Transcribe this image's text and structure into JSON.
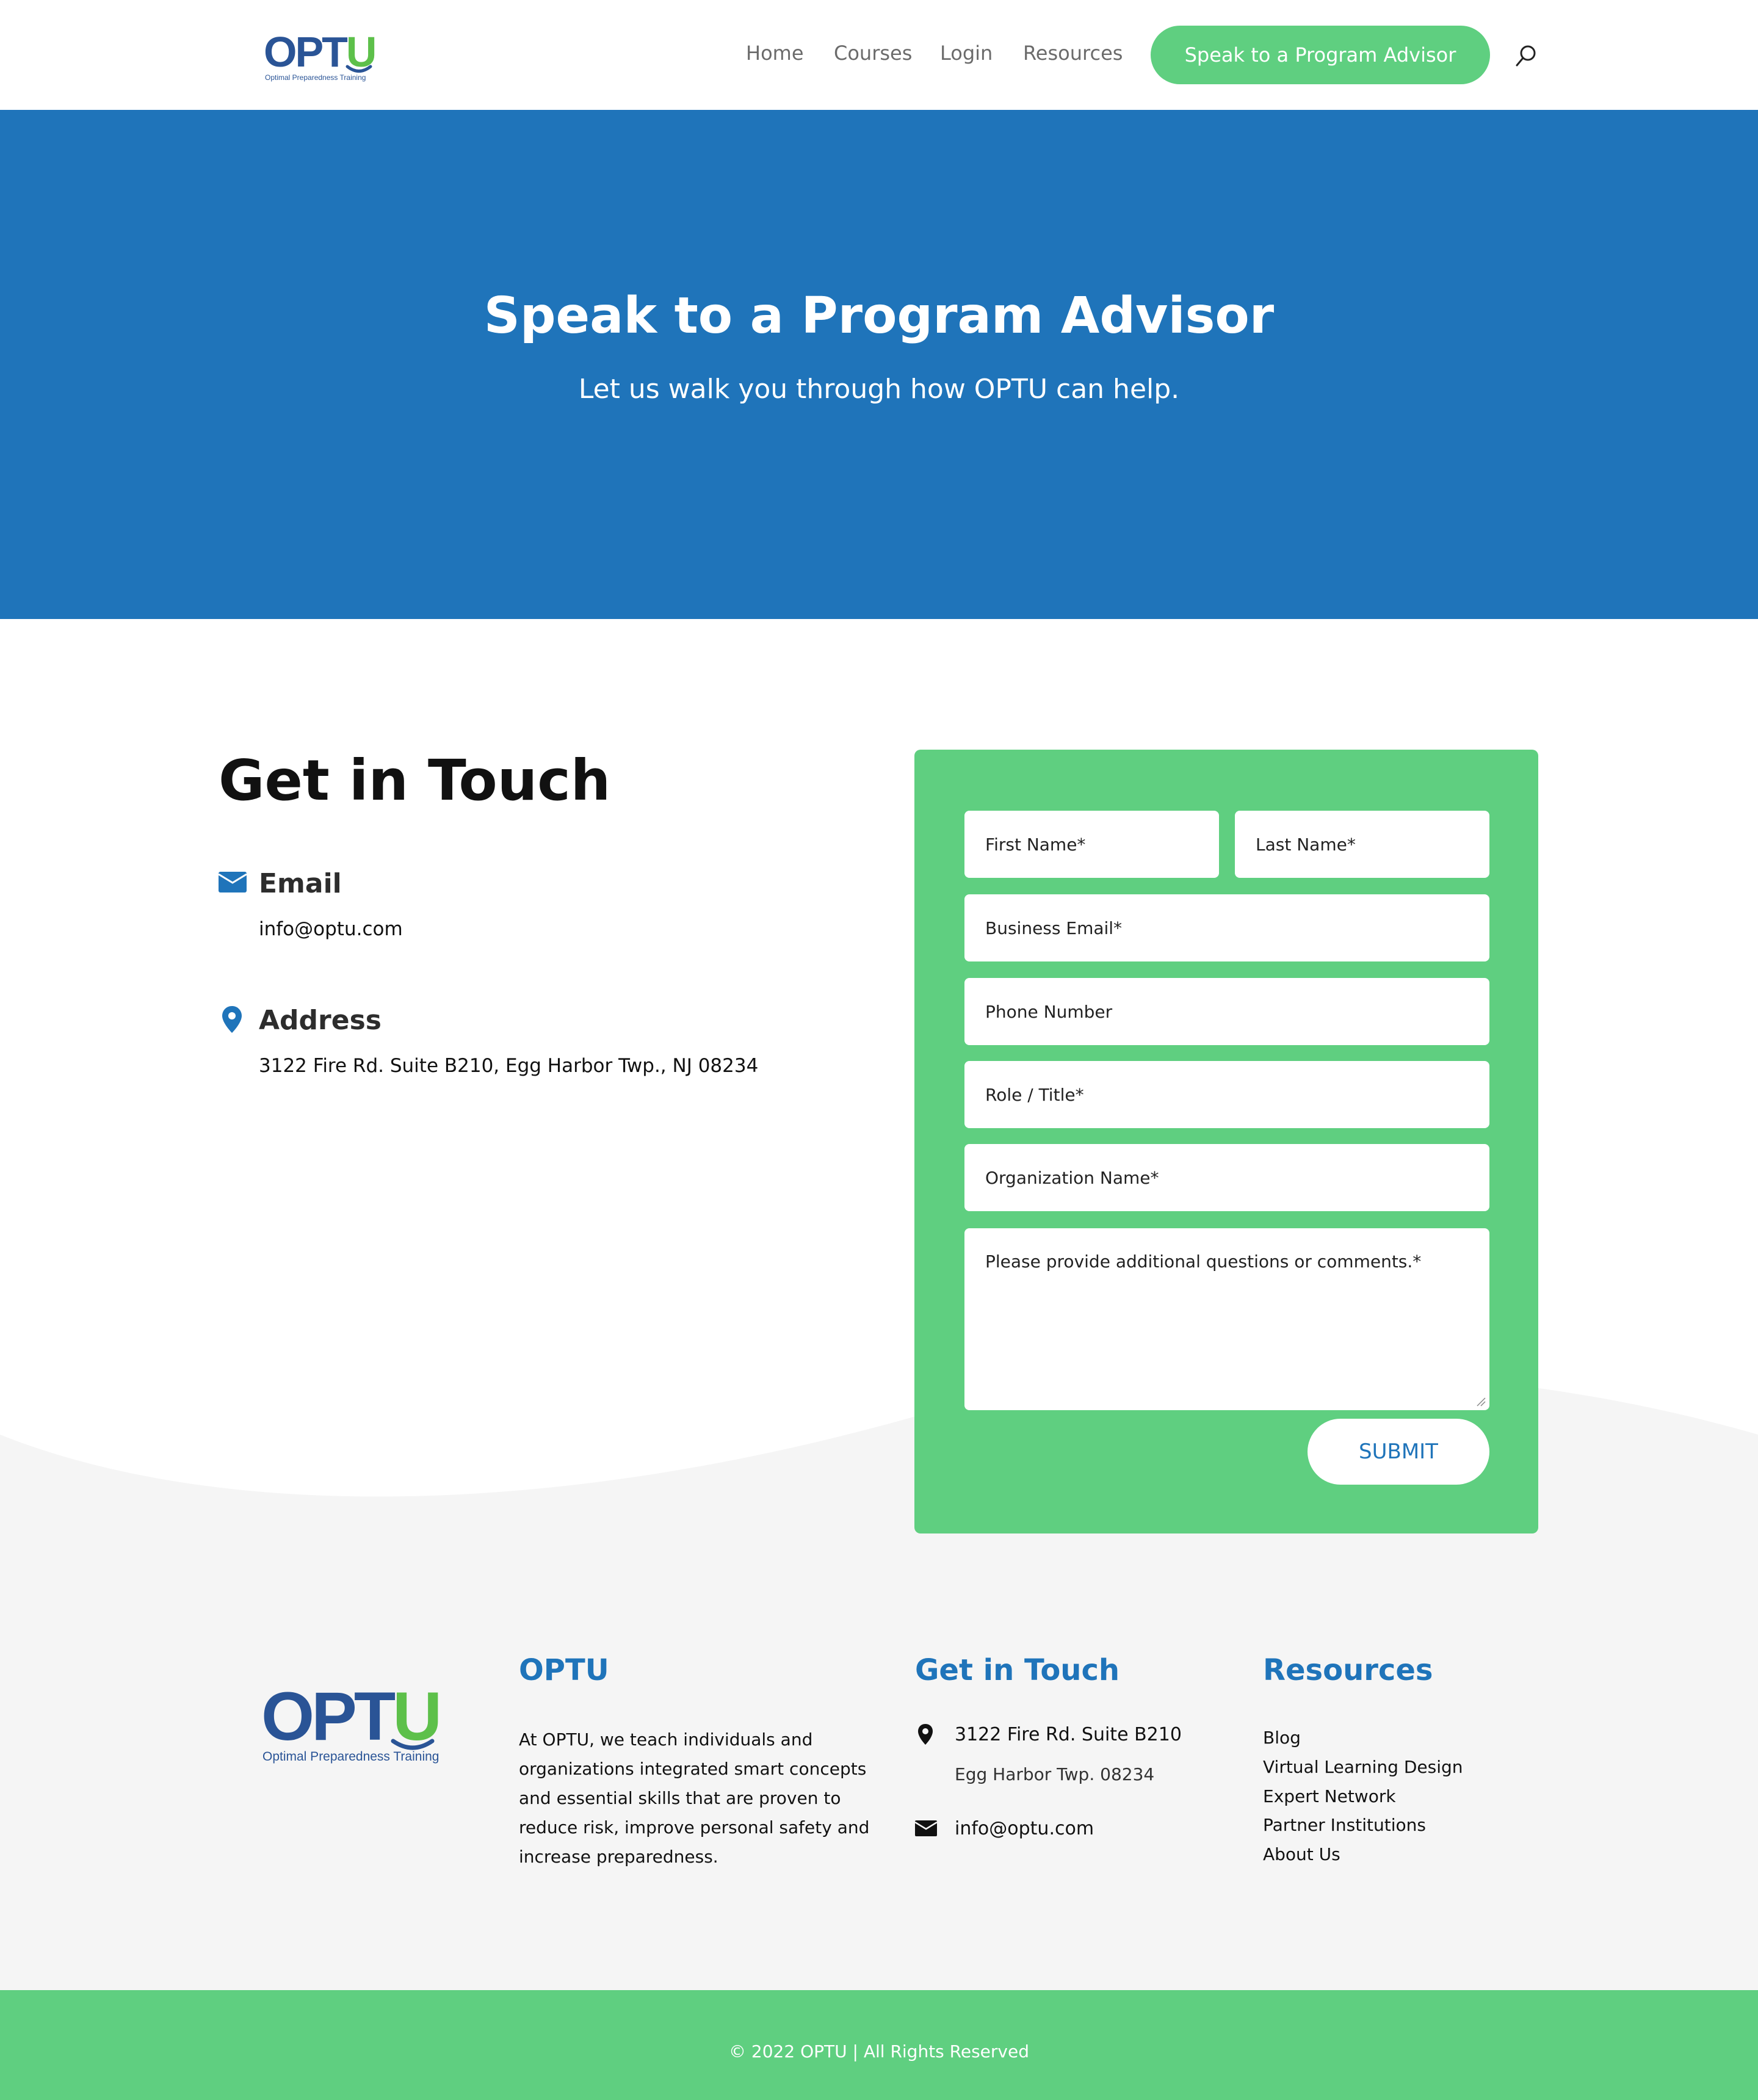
{
  "header": {
    "logo": {
      "text_main": "OPT",
      "text_accent": "U",
      "tagline": "Optimal Preparedness Training"
    },
    "nav": [
      "Home",
      "Courses",
      "Login",
      "Resources"
    ],
    "cta_label": "Speak to a Program Advisor",
    "search_icon": "search-icon"
  },
  "hero": {
    "title": "Speak to a Program Advisor",
    "subtitle": "Let us walk you through how OPTU can help."
  },
  "contact": {
    "title": "Get in Touch",
    "email_heading": "Email",
    "email_value": "info@optu.com",
    "address_heading": "Address",
    "address_value": "3122 Fire Rd. Suite B210, Egg Harbor Twp., NJ 08234"
  },
  "form": {
    "first_name": "First Name*",
    "last_name": "Last Name*",
    "business_email": "Business Email*",
    "phone": "Phone Number",
    "role": "Role / Title*",
    "organization": "Organization Name*",
    "comments": "Please provide additional questions or comments.*",
    "submit_label": "SUBMIT"
  },
  "footer": {
    "logo": {
      "text_main": "OPT",
      "text_accent": "U",
      "tagline": "Optimal Preparedness Training"
    },
    "about_title": "OPTU",
    "about_text": "At OPTU, we teach individuals and organizations integrated smart concepts and essential skills that are proven to reduce risk, improve personal safety and increase preparedness.",
    "contact_title": "Get in Touch",
    "address_line1": "3122 Fire Rd. Suite B210",
    "address_line2": "Egg Harbor Twp. 08234",
    "email": "info@optu.com",
    "resources_title": "Resources",
    "resources": [
      "Blog",
      "Virtual Learning Design",
      "Expert Network",
      "Partner Institutions",
      "About Us"
    ],
    "copyright": "© 2022 OPTU | All Rights Reserved"
  },
  "colors": {
    "brand_blue": "#1f74ba",
    "brand_green": "#5fcf80",
    "logo_blue": "#2a5496",
    "logo_green": "#5dc04a",
    "footer_bg": "#f5f5f5"
  }
}
